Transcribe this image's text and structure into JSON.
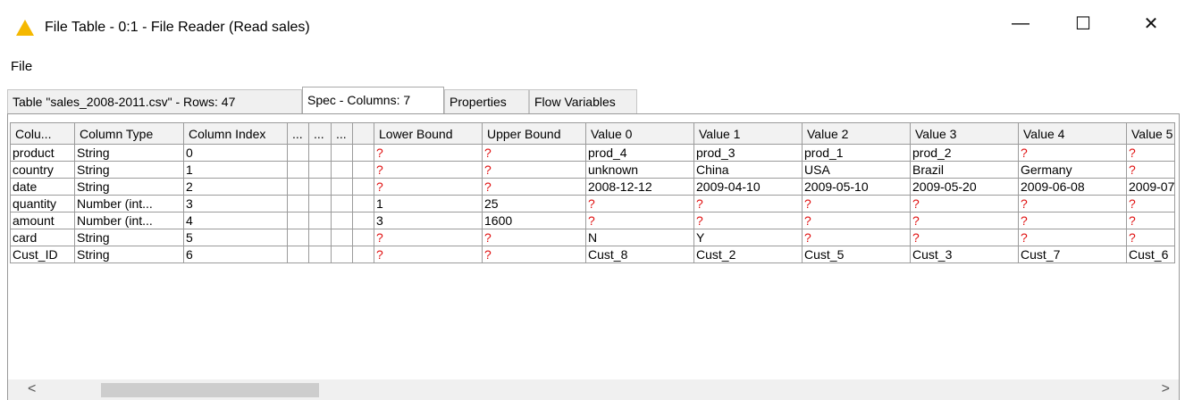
{
  "window": {
    "title": "File Table - 0:1 - File Reader (Read sales)",
    "minimize": "—",
    "maximize": "☐",
    "close": "✕"
  },
  "menu": {
    "file": "File"
  },
  "tabs": [
    {
      "label": "Table \"sales_2008-2011.csv\" - Rows: 47"
    },
    {
      "label": "Spec - Columns: 7"
    },
    {
      "label": "Properties"
    },
    {
      "label": "Flow Variables"
    }
  ],
  "columns": [
    "Colu...",
    "Column Type",
    "Column Index",
    "...",
    "...",
    "...",
    "Lower Bound",
    "Upper Bound",
    "Value 0",
    "Value 1",
    "Value 2",
    "Value 3",
    "Value 4",
    "Value 5"
  ],
  "rows": [
    [
      "product",
      "String",
      "0",
      "",
      "",
      "",
      "?",
      "?",
      "prod_4",
      "prod_3",
      "prod_1",
      "prod_2",
      "?",
      "?"
    ],
    [
      "country",
      "String",
      "1",
      "",
      "",
      "",
      "?",
      "?",
      "unknown",
      "China",
      "USA",
      "Brazil",
      "Germany",
      "?"
    ],
    [
      "date",
      "String",
      "2",
      "",
      "",
      "",
      "?",
      "?",
      "2008-12-12",
      "2009-04-10",
      "2009-05-10",
      "2009-05-20",
      "2009-06-08",
      "2009-07"
    ],
    [
      "quantity",
      "Number (int...",
      "3",
      "",
      "",
      "",
      "1",
      "25",
      "?",
      "?",
      "?",
      "?",
      "?",
      "?"
    ],
    [
      "amount",
      "Number (int...",
      "4",
      "",
      "",
      "",
      "3",
      "1600",
      "?",
      "?",
      "?",
      "?",
      "?",
      "?"
    ],
    [
      "card",
      "String",
      "5",
      "",
      "",
      "",
      "?",
      "?",
      "N",
      "Y",
      "?",
      "?",
      "?",
      "?"
    ],
    [
      "Cust_ID",
      "String",
      "6",
      "",
      "",
      "",
      "?",
      "?",
      "Cust_8",
      "Cust_2",
      "Cust_5",
      "Cust_3",
      "Cust_7",
      "Cust_6"
    ]
  ],
  "scrollbar": {
    "left_arrow": "<",
    "right_arrow": ">"
  },
  "colors": {
    "missing": "#e01010",
    "warning_icon": "#f5b800"
  }
}
